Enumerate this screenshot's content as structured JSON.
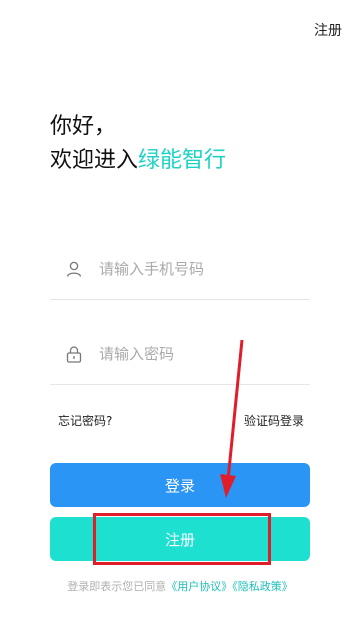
{
  "header": {
    "register_link": "注册"
  },
  "greeting": {
    "line1": "你好，",
    "line2_prefix": "欢迎进入",
    "brand": "绿能智行"
  },
  "form": {
    "phone_placeholder": "请输入手机号码",
    "password_placeholder": "请输入密码",
    "phone_icon": "user-icon",
    "password_icon": "lock-icon"
  },
  "links": {
    "forgot_password": "忘记密码?",
    "sms_login": "验证码登录"
  },
  "buttons": {
    "login": "登录",
    "register": "注册"
  },
  "agreement": {
    "prefix": "登录即表示您已同意",
    "user_agreement": "《用户协议》",
    "privacy_policy": "《隐私政策》"
  },
  "colors": {
    "brand": "#1dd3c3",
    "login_button": "#2b95f5",
    "register_button": "#1de0d0",
    "annotation": "#e01e2b"
  }
}
